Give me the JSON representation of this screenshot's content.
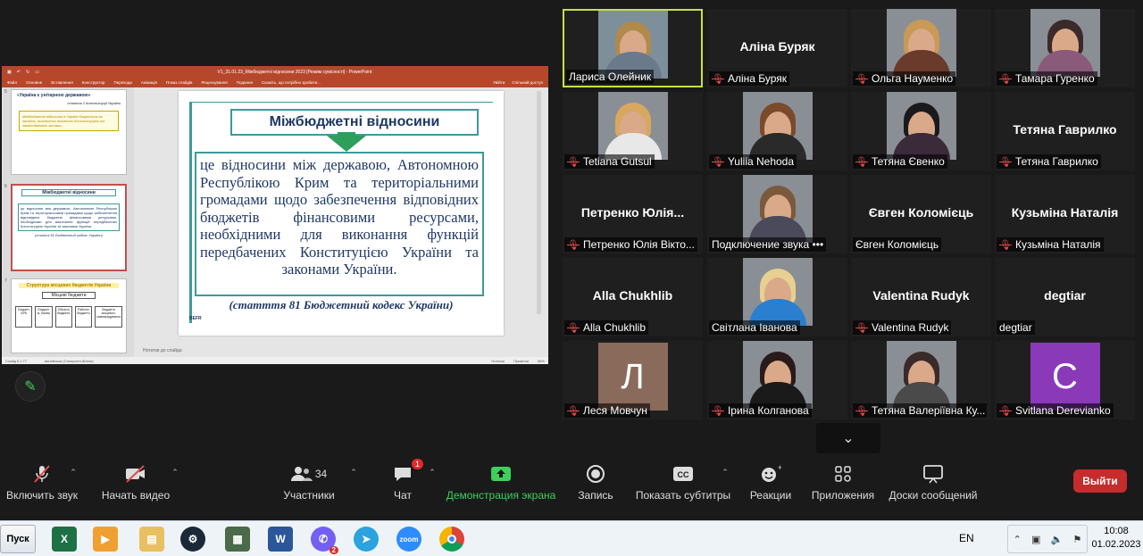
{
  "share": {
    "window_title": "V1_31.01.23_Міжбюджетні відносини 2023 [Режим сумісності] - PowerPoint",
    "ribbon_tabs": [
      "Файл",
      "Основне",
      "Вставлення",
      "Конструктор",
      "Переходи",
      "Анімація",
      "Показ слайдів",
      "Рецензування",
      "Подання",
      "Скажіть, що потрібно зробити..."
    ],
    "ribbon_right": [
      "Увійти",
      "Спільний доступ"
    ],
    "thumb5_title": "«Україна є унітарною державою»",
    "thumb5_sub": "стаття 2 Конституції України",
    "thumb5_body": "Міжбюджетні відносини в Україні базуються на засадах, визначених виключно Конституцією та законодавчими актами.",
    "thumb6_title": "Міжбюджетні відносини",
    "thumb6_body": "це відносини між державою, Автономною Республікою Крим та територіальними громадами щодо забезпечення відповідних бюджетів фінансовими ресурсами, необхідними для виконання функцій передбачених Конституцією України та законами України.",
    "thumb6_foot": "(статті 81 Бюджетний кодекс України)",
    "thumb7_title": "Структура місцевих бюджетів України",
    "thumb7_sub": "Місцеві бюджети",
    "thumb7_cols": [
      "Бюджет АРК",
      "Бюджет м. Києва",
      "Обласні бюджети",
      "Районні бюджети",
      "Бюджети місцевого самоврядування"
    ],
    "thumb_numbers": [
      "5",
      "6",
      "7"
    ],
    "slide_title": "Міжбюджетні відносини",
    "slide_body": "це відносини між державою, Автономною Республікою Крим та територіальними громадами щодо забезпечення відповідних бюджетів фінансовими ресурсами, необхідними для виконання функцій передбачених Конституцією України та законами України.",
    "slide_footer": "(статття 81 Бюджетний кодекс України)",
    "slide_logo": "BEFR",
    "notes_placeholder": "Нотатки до слайда",
    "status_left": "Слайд 6 з 77",
    "status_lang": "англійська (Сполучені Штати)",
    "status_notes": "Нотатки",
    "status_comments": "Примітки",
    "status_zoom": "56%"
  },
  "gallery": [
    {
      "name": "Лариса Олейник",
      "big": "",
      "muted": false,
      "video": true,
      "hair": "#b08a4a",
      "body": "#6b7a8a",
      "active": true
    },
    {
      "name": "Аліна Буряк",
      "big": "Аліна Буряк",
      "muted": true,
      "video": false
    },
    {
      "name": "Ольга Науменко",
      "big": "",
      "muted": true,
      "video": true,
      "hair": "#c89a55",
      "body": "#6a3a2a"
    },
    {
      "name": "Тамара Гуренко",
      "big": "",
      "muted": true,
      "video": true,
      "hair": "#3a2a2a",
      "body": "#8a5a7a"
    },
    {
      "name": "Tetiana Gutsul",
      "big": "",
      "muted": true,
      "video": true,
      "hair": "#d8a860",
      "body": "#e8e8e8"
    },
    {
      "name": "Yuliia Nehoda",
      "big": "",
      "muted": true,
      "video": true,
      "hair": "#7a4a2a",
      "body": "#2a2a2a"
    },
    {
      "name": "Тетяна Євенко",
      "big": "",
      "muted": true,
      "video": true,
      "hair": "#1a1a1a",
      "body": "#3a2a3a"
    },
    {
      "name": "Тетяна Гаврилко",
      "big": "Тетяна Гаврилко",
      "muted": true,
      "video": false
    },
    {
      "name": "Петренко Юлія Вікто...",
      "big": "Петренко  Юлія...",
      "muted": true,
      "video": false
    },
    {
      "name": "Подключение звука •••",
      "big": "",
      "muted": false,
      "video": true,
      "hair": "#7a5a3a",
      "body": "#4a4a5a"
    },
    {
      "name": "Євген Коломієць",
      "big": "Євген Коломієць",
      "muted": false,
      "video": false
    },
    {
      "name": "Кузьміна Наталія",
      "big": "Кузьміна Наталія",
      "muted": true,
      "video": false
    },
    {
      "name": "Alla Chukhlib",
      "big": "Alla Chukhlib",
      "muted": true,
      "video": false
    },
    {
      "name": "Світлана Іванова",
      "big": "",
      "muted": false,
      "video": true,
      "hair": "#e8d090",
      "body": "#2a7fd0"
    },
    {
      "name": "Valentina Rudyk",
      "big": "Valentina Rudyk",
      "muted": true,
      "video": false
    },
    {
      "name": "degtiar",
      "big": "degtiar",
      "muted": false,
      "video": false
    },
    {
      "name": "Леся Мовчун",
      "big": "",
      "muted": true,
      "video": false,
      "letter": "Л",
      "letter_bg": "#8a6a5a"
    },
    {
      "name": "Ірина Колганова",
      "big": "",
      "muted": true,
      "video": true,
      "hair": "#2a1a1a",
      "body": "#1a1a1a"
    },
    {
      "name": "Тетяна Валеріївна Ку...",
      "big": "",
      "muted": true,
      "video": true,
      "hair": "#3a2a2a",
      "body": "#4a4a4a"
    },
    {
      "name": "Svitlana Derevianko",
      "big": "",
      "muted": true,
      "video": false,
      "letter": "C",
      "letter_bg": "#8a3ab9"
    }
  ],
  "toolbar": {
    "unmute": "Включить звук",
    "start_video": "Начать видео",
    "participants": "Участники",
    "participants_count": "34",
    "chat": "Чат",
    "chat_badge": "1",
    "share": "Демонстрация экрана",
    "record": "Запись",
    "captions": "Показать субтитры",
    "reactions": "Реакции",
    "apps": "Приложения",
    "whiteboards": "Доски сообщений",
    "leave": "Выйти"
  },
  "taskbar": {
    "start": "Пуск",
    "lang": "EN",
    "time": "10:08",
    "date": "01.02.2023",
    "viber_badge": "2",
    "zoom_label": "zoom"
  },
  "colors": {
    "ppt_accent": "#b7472a",
    "zoom_green": "#3fcf5c",
    "leave_red": "#c62c2c",
    "slide_teal": "#3d9a9b",
    "slide_navy": "#1f3864"
  }
}
